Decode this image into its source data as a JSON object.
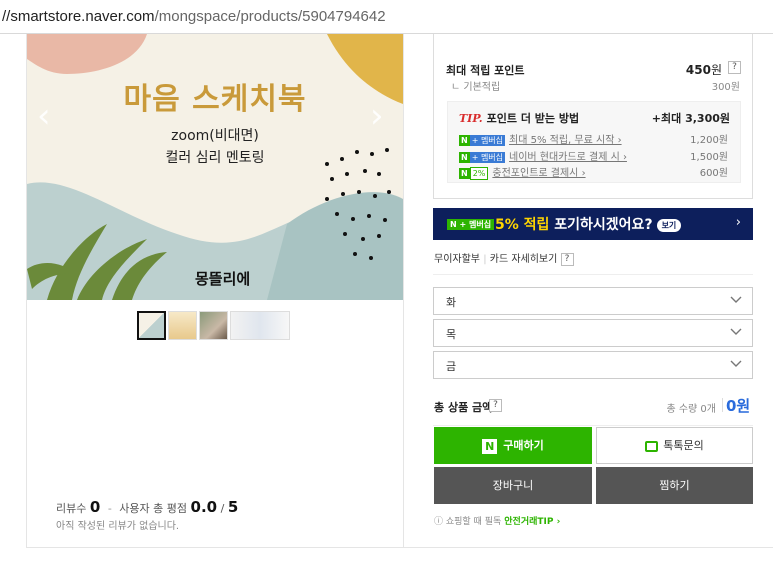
{
  "browser": {
    "url_host": "//smartstore.naver.com",
    "url_path": "/mongspace/products/5904794642"
  },
  "product_image": {
    "title": "마음 스케치북",
    "subtitle1": "zoom(비대면)",
    "subtitle2": "컬러 심리 멘토링",
    "brand": "몽뜰리에"
  },
  "review": {
    "label_count": "리뷰수",
    "count": "0",
    "sep": "-",
    "label_score": "사용자 총 평점",
    "score": "0.0",
    "score_sep": "/",
    "score_max": "5",
    "empty_text": "아직 작성된 리뷰가 없습니다."
  },
  "points": {
    "title": "최대 적립 포인트",
    "value": "450",
    "unit": "원",
    "help": "?",
    "base_label": "기본적립",
    "base_value": "300원"
  },
  "tip": {
    "label": "TIP.",
    "title": "포인트 더 받는 방법",
    "max": "+최대 3,300원",
    "rows": [
      {
        "badge": "N",
        "extra": "+ 멤버십",
        "text": "최대 5% 적립, 무료 시작 ›",
        "amount": "1,200원"
      },
      {
        "badge": "N",
        "extra": "+ 멤버십",
        "text": "네이버 현대카드로 결제 시 ›",
        "amount": "1,500원"
      },
      {
        "badge": "N",
        "extra": "2%",
        "text": "충전포인트로 결제시 ›",
        "amount": "600원"
      }
    ]
  },
  "banner": {
    "badge": "N + 멤버십",
    "highlight": "5% 적립",
    "text": " 포기하시겠어요?",
    "pill": "보기",
    "arrow": "›"
  },
  "card_links": {
    "installment": "무이자할부",
    "card_benefit": "카드 자세히보기",
    "help": "?"
  },
  "options": [
    {
      "value": "화"
    },
    {
      "value": "목"
    },
    {
      "value": "금"
    }
  ],
  "total": {
    "label": "총 상품 금액",
    "help": "?",
    "qty": "총 수량 0개",
    "price": "0원"
  },
  "buttons": {
    "buy": "구매하기",
    "buy_icon": "N",
    "talk": "톡톡문의",
    "cart": "장바구니",
    "wish": "찜하기"
  },
  "safe_deal": {
    "prefix": "ⓘ 쇼핑할 때 필독",
    "link": "안전거래TIP ›"
  },
  "colors": {
    "naver_green": "#2db400",
    "banner_navy": "#0d1f5c",
    "price_blue": "#2a6bdc"
  }
}
